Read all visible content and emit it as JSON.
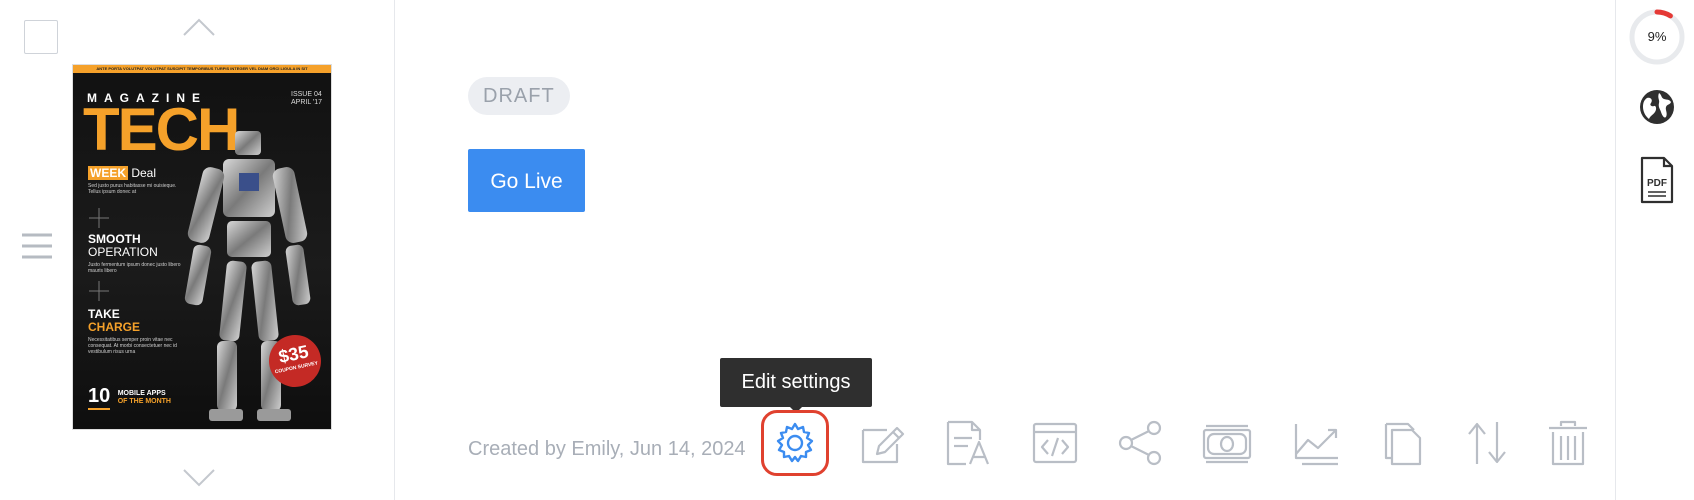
{
  "cover": {
    "top_banner": "ANTE PORTA VOLUTPAT VOLUTPAT SUSCIPIT TEMPORIBUS TURPIS INTEGER VEL DIAM ORCI LIGULA IN SIT",
    "masthead_small": "MAGAZINE",
    "masthead_big": "TECH",
    "issue": "ISSUE 04",
    "issue_date": "APRIL '17",
    "week_highlight": "WEEK",
    "week_rest": "Deal",
    "week_text": "Sed justo purus habitasse mi ouisieque. Tellus ipsum donec at",
    "smooth_title": "SMOOTH",
    "smooth_sub": "OPERATION",
    "smooth_text": "Justo fermentum ipsum donec justo libero mauris libero",
    "take_title": "TAKE",
    "take_sub": "CHARGE",
    "take_text": "Necessitatibus semper proin vitae nec consequat. At morbi consectetuer nec id vestibulum risus urna",
    "seal_value": "$35",
    "seal_text": "COUPON SURVEY",
    "apps_number": "10",
    "apps_line1": "MOBILE APPS",
    "apps_line2": "OF THE MONTH"
  },
  "item": {
    "status": "DRAFT",
    "go_live_label": "Go Live",
    "created_text": "Created by Emily, Jun 14, 2024"
  },
  "tooltip": {
    "text": "Edit settings"
  },
  "actions": [
    {
      "icon": "gear-icon",
      "name": "edit-settings-button"
    },
    {
      "icon": "pencil-icon",
      "name": "edit-content-button"
    },
    {
      "icon": "text-edit-icon",
      "name": "edit-text-button"
    },
    {
      "icon": "embed-code-icon",
      "name": "embed-button"
    },
    {
      "icon": "share-icon",
      "name": "share-button"
    },
    {
      "icon": "money-icon",
      "name": "monetize-button"
    },
    {
      "icon": "chart-line-icon",
      "name": "stats-button"
    },
    {
      "icon": "copy-icon",
      "name": "duplicate-button"
    },
    {
      "icon": "sort-arrows-icon",
      "name": "reorder-button"
    },
    {
      "icon": "trash-icon",
      "name": "delete-button"
    }
  ],
  "sidebar_right": {
    "progress_percent": 9,
    "progress_label": "9%",
    "pdf_label": "PDF"
  },
  "colors": {
    "accent": "#3b8cf0",
    "highlight_border": "#e0412f",
    "icon_gray": "#b9bec6",
    "icon_blue": "#3b8cf0",
    "progress_red": "#e53935"
  }
}
